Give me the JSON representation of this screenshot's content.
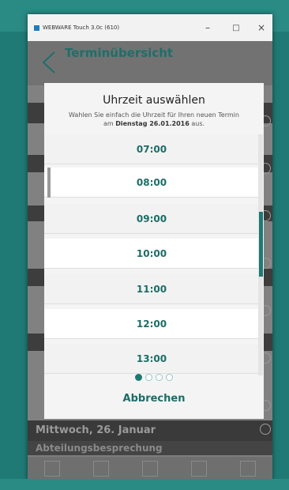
{
  "window": {
    "title": "WEBWARE Touch 3.0c (610)",
    "minimize": "–",
    "maximize": "□",
    "close": "×"
  },
  "app": {
    "title": "Terminübersicht"
  },
  "background": {
    "day_header": "Mittwoch, 26. Januar",
    "next_item": "Abteilungsbesprechung"
  },
  "dialog": {
    "title": "Uhrzeit auswählen",
    "subtitle_pre": "Wahlen Sie einfach die Uhrzeit für Ihren neuen Termin am",
    "subtitle_date": "Dienstag 26.01.2016",
    "subtitle_post": "aus.",
    "times": [
      "07:00",
      "08:00",
      "09:00",
      "10:00",
      "11:00",
      "12:00",
      "13:00"
    ],
    "pager": {
      "pages": 4,
      "active": 0
    },
    "cancel_label": "Abbrechen"
  },
  "colors": {
    "accent": "#1c7a73",
    "overlay": "#7d7d7d",
    "dialog_bg": "#f4f4f4"
  },
  "icons": {
    "back": "chevron-left-icon",
    "app": "app-icon"
  }
}
